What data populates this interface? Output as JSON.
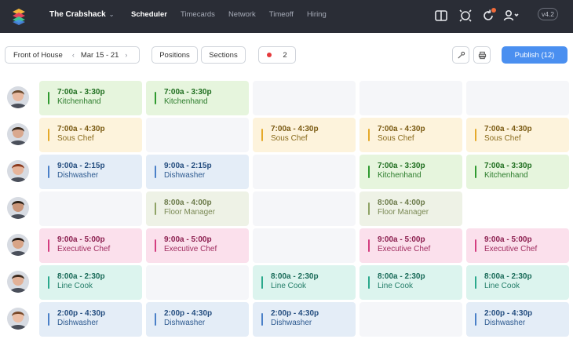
{
  "header": {
    "brand": "The Crabshack",
    "nav": [
      "Scheduler",
      "Timecards",
      "Network",
      "Timeoff",
      "Hiring"
    ],
    "active_nav": "Scheduler",
    "version": "v4.2",
    "colors": {
      "bar_bg": "#2a2d36",
      "notification": "#f26b3a"
    }
  },
  "toolbar": {
    "location": "Front of House",
    "week_range": "Mar 15 - 21",
    "positions_label": "Positions",
    "sections_label": "Sections",
    "alert_count": "2",
    "publish_label": "Publish (12)",
    "colors": {
      "publish": "#4a8ff0",
      "alert_dot": "#e5393b"
    }
  },
  "schedule": {
    "rows": [
      {
        "avatar": "avatar-1",
        "cells": [
          {
            "time": "7:00a - 3:30p",
            "role": "Kitchenhand",
            "color": "green"
          },
          {
            "time": "7:00a - 3:30p",
            "role": "Kitchenhand",
            "color": "green"
          },
          null,
          null,
          null
        ]
      },
      {
        "avatar": "avatar-2",
        "cells": [
          {
            "time": "7:00a - 4:30p",
            "role": "Sous Chef",
            "color": "yellow"
          },
          null,
          {
            "time": "7:00a - 4:30p",
            "role": "Sous Chef",
            "color": "yellow"
          },
          {
            "time": "7:00a - 4:30p",
            "role": "Sous Chef",
            "color": "yellow"
          },
          {
            "time": "7:00a - 4:30p",
            "role": "Sous Chef",
            "color": "yellow"
          }
        ]
      },
      {
        "avatar": "avatar-3",
        "cells": [
          {
            "time": "9:00a - 2:15p",
            "role": "Dishwasher",
            "color": "blue"
          },
          {
            "time": "9:00a - 2:15p",
            "role": "Dishwasher",
            "color": "blue"
          },
          null,
          {
            "time": "7:00a - 3:30p",
            "role": "Kitchenhand",
            "color": "green"
          },
          {
            "time": "7:00a - 3:30p",
            "role": "Kitchenhand",
            "color": "green"
          }
        ]
      },
      {
        "avatar": "avatar-4",
        "cells": [
          null,
          {
            "time": "8:00a - 4:00p",
            "role": "Floor Manager",
            "color": "olive"
          },
          null,
          {
            "time": "8:00a - 4:00p",
            "role": "Floor Manager",
            "color": "olive"
          },
          "none"
        ]
      },
      {
        "avatar": "avatar-5",
        "cells": [
          {
            "time": "9:00a - 5:00p",
            "role": "Executive Chef",
            "color": "pink"
          },
          {
            "time": "9:00a - 5:00p",
            "role": "Executive Chef",
            "color": "pink"
          },
          null,
          {
            "time": "9:00a - 5:00p",
            "role": "Executive Chef",
            "color": "pink"
          },
          {
            "time": "9:00a - 5:00p",
            "role": "Executive Chef",
            "color": "pink"
          }
        ]
      },
      {
        "avatar": "avatar-6",
        "cells": [
          {
            "time": "8:00a - 2:30p",
            "role": "Line Cook",
            "color": "teal"
          },
          null,
          {
            "time": "8:00a - 2:30p",
            "role": "Line Cook",
            "color": "teal"
          },
          {
            "time": "8:00a - 2:30p",
            "role": "Line Cook",
            "color": "teal"
          },
          {
            "time": "8:00a - 2:30p",
            "role": "Line Cook",
            "color": "teal"
          }
        ]
      },
      {
        "avatar": "avatar-7",
        "cells": [
          {
            "time": "2:00p - 4:30p",
            "role": "Dishwasher",
            "color": "blue"
          },
          {
            "time": "2:00p - 4:30p",
            "role": "Dishwasher",
            "color": "blue"
          },
          {
            "time": "2:00p - 4:30p",
            "role": "Dishwasher",
            "color": "blue"
          },
          null,
          {
            "time": "2:00p - 4:30p",
            "role": "Dishwasher",
            "color": "blue"
          }
        ]
      }
    ]
  }
}
